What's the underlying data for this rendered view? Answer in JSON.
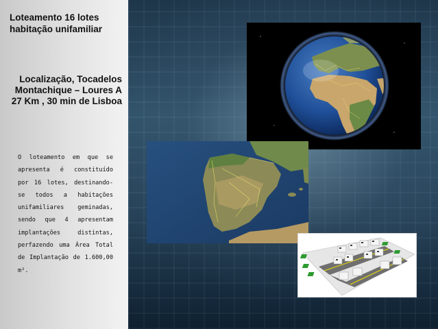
{
  "slide": {
    "title": "Loteamento 16 lotes habitação unifamiliar",
    "location": "Localização, Tocadelos Montachique – Loures A 27 Km  , 30 min de Lisboa",
    "description": "O loteamento em que se apresenta é constituído por 16 lotes, destinando-se todos a habitações unifamiliares geminadas, sendo que 4 apresentam implantações distintas, perfazendo uma Área Total de Implantação de 1.600,00 m².",
    "images": [
      {
        "name": "globe-satellite-image",
        "content": "Earth globe showing Europe and Africa"
      },
      {
        "name": "iberia-satellite-map",
        "content": "Satellite map of the Iberian Peninsula"
      },
      {
        "name": "housing-3d-render",
        "content": "3D render of semi-detached houses"
      }
    ]
  },
  "colors": {
    "sidebar": "#e2e2e2",
    "background": "#2a4860",
    "text": "#111111"
  }
}
